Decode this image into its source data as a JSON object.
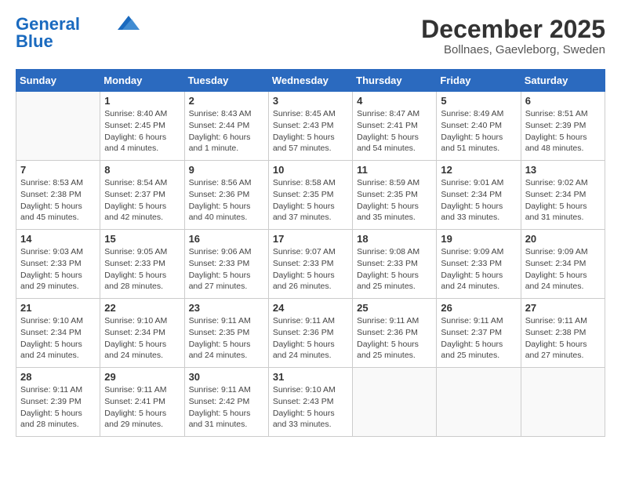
{
  "header": {
    "logo_line1": "General",
    "logo_line2": "Blue",
    "month": "December 2025",
    "location": "Bollnaes, Gaevleborg, Sweden"
  },
  "days_of_week": [
    "Sunday",
    "Monday",
    "Tuesday",
    "Wednesday",
    "Thursday",
    "Friday",
    "Saturday"
  ],
  "weeks": [
    [
      {
        "day": "",
        "detail": ""
      },
      {
        "day": "1",
        "detail": "Sunrise: 8:40 AM\nSunset: 2:45 PM\nDaylight: 6 hours\nand 4 minutes."
      },
      {
        "day": "2",
        "detail": "Sunrise: 8:43 AM\nSunset: 2:44 PM\nDaylight: 6 hours\nand 1 minute."
      },
      {
        "day": "3",
        "detail": "Sunrise: 8:45 AM\nSunset: 2:43 PM\nDaylight: 5 hours\nand 57 minutes."
      },
      {
        "day": "4",
        "detail": "Sunrise: 8:47 AM\nSunset: 2:41 PM\nDaylight: 5 hours\nand 54 minutes."
      },
      {
        "day": "5",
        "detail": "Sunrise: 8:49 AM\nSunset: 2:40 PM\nDaylight: 5 hours\nand 51 minutes."
      },
      {
        "day": "6",
        "detail": "Sunrise: 8:51 AM\nSunset: 2:39 PM\nDaylight: 5 hours\nand 48 minutes."
      }
    ],
    [
      {
        "day": "7",
        "detail": "Sunrise: 8:53 AM\nSunset: 2:38 PM\nDaylight: 5 hours\nand 45 minutes."
      },
      {
        "day": "8",
        "detail": "Sunrise: 8:54 AM\nSunset: 2:37 PM\nDaylight: 5 hours\nand 42 minutes."
      },
      {
        "day": "9",
        "detail": "Sunrise: 8:56 AM\nSunset: 2:36 PM\nDaylight: 5 hours\nand 40 minutes."
      },
      {
        "day": "10",
        "detail": "Sunrise: 8:58 AM\nSunset: 2:35 PM\nDaylight: 5 hours\nand 37 minutes."
      },
      {
        "day": "11",
        "detail": "Sunrise: 8:59 AM\nSunset: 2:35 PM\nDaylight: 5 hours\nand 35 minutes."
      },
      {
        "day": "12",
        "detail": "Sunrise: 9:01 AM\nSunset: 2:34 PM\nDaylight: 5 hours\nand 33 minutes."
      },
      {
        "day": "13",
        "detail": "Sunrise: 9:02 AM\nSunset: 2:34 PM\nDaylight: 5 hours\nand 31 minutes."
      }
    ],
    [
      {
        "day": "14",
        "detail": "Sunrise: 9:03 AM\nSunset: 2:33 PM\nDaylight: 5 hours\nand 29 minutes."
      },
      {
        "day": "15",
        "detail": "Sunrise: 9:05 AM\nSunset: 2:33 PM\nDaylight: 5 hours\nand 28 minutes."
      },
      {
        "day": "16",
        "detail": "Sunrise: 9:06 AM\nSunset: 2:33 PM\nDaylight: 5 hours\nand 27 minutes."
      },
      {
        "day": "17",
        "detail": "Sunrise: 9:07 AM\nSunset: 2:33 PM\nDaylight: 5 hours\nand 26 minutes."
      },
      {
        "day": "18",
        "detail": "Sunrise: 9:08 AM\nSunset: 2:33 PM\nDaylight: 5 hours\nand 25 minutes."
      },
      {
        "day": "19",
        "detail": "Sunrise: 9:09 AM\nSunset: 2:33 PM\nDaylight: 5 hours\nand 24 minutes."
      },
      {
        "day": "20",
        "detail": "Sunrise: 9:09 AM\nSunset: 2:34 PM\nDaylight: 5 hours\nand 24 minutes."
      }
    ],
    [
      {
        "day": "21",
        "detail": "Sunrise: 9:10 AM\nSunset: 2:34 PM\nDaylight: 5 hours\nand 24 minutes."
      },
      {
        "day": "22",
        "detail": "Sunrise: 9:10 AM\nSunset: 2:34 PM\nDaylight: 5 hours\nand 24 minutes."
      },
      {
        "day": "23",
        "detail": "Sunrise: 9:11 AM\nSunset: 2:35 PM\nDaylight: 5 hours\nand 24 minutes."
      },
      {
        "day": "24",
        "detail": "Sunrise: 9:11 AM\nSunset: 2:36 PM\nDaylight: 5 hours\nand 24 minutes."
      },
      {
        "day": "25",
        "detail": "Sunrise: 9:11 AM\nSunset: 2:36 PM\nDaylight: 5 hours\nand 25 minutes."
      },
      {
        "day": "26",
        "detail": "Sunrise: 9:11 AM\nSunset: 2:37 PM\nDaylight: 5 hours\nand 25 minutes."
      },
      {
        "day": "27",
        "detail": "Sunrise: 9:11 AM\nSunset: 2:38 PM\nDaylight: 5 hours\nand 27 minutes."
      }
    ],
    [
      {
        "day": "28",
        "detail": "Sunrise: 9:11 AM\nSunset: 2:39 PM\nDaylight: 5 hours\nand 28 minutes."
      },
      {
        "day": "29",
        "detail": "Sunrise: 9:11 AM\nSunset: 2:41 PM\nDaylight: 5 hours\nand 29 minutes."
      },
      {
        "day": "30",
        "detail": "Sunrise: 9:11 AM\nSunset: 2:42 PM\nDaylight: 5 hours\nand 31 minutes."
      },
      {
        "day": "31",
        "detail": "Sunrise: 9:10 AM\nSunset: 2:43 PM\nDaylight: 5 hours\nand 33 minutes."
      },
      {
        "day": "",
        "detail": ""
      },
      {
        "day": "",
        "detail": ""
      },
      {
        "day": "",
        "detail": ""
      }
    ]
  ]
}
